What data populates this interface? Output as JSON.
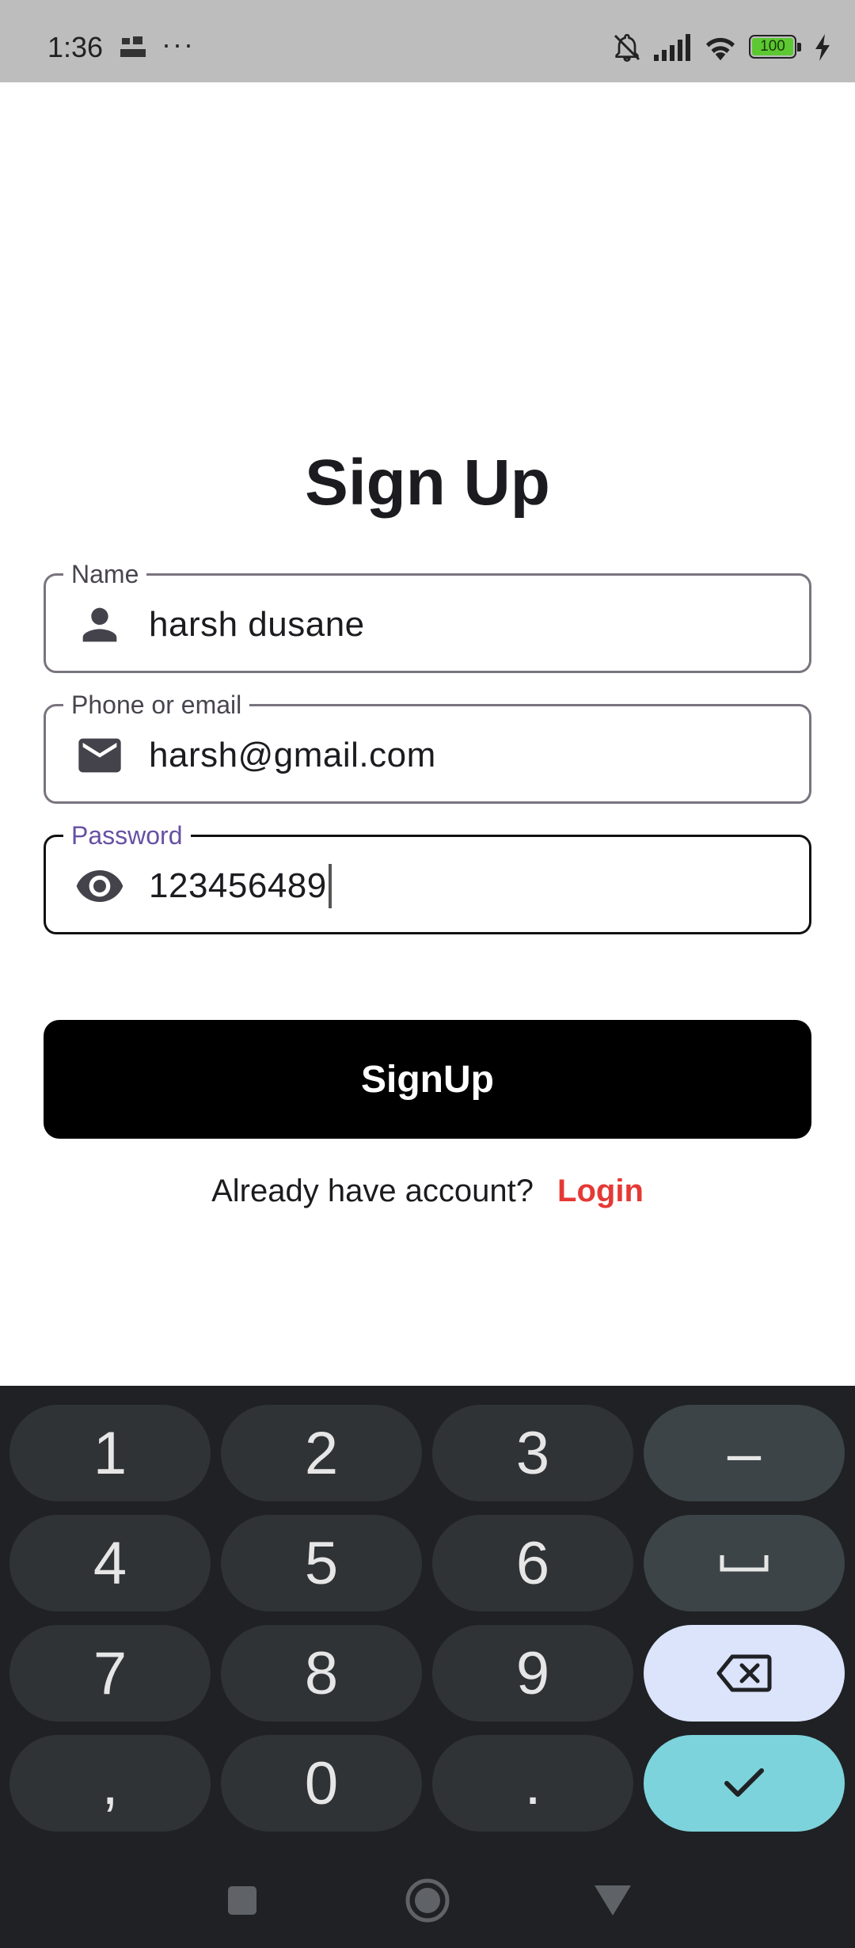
{
  "status_bar": {
    "time": "1:36",
    "notification_icon": "app-notification-icon",
    "more": "···",
    "battery": "100",
    "icons": [
      "bell-off-icon",
      "signal-icon",
      "wifi-icon",
      "battery-icon",
      "charging-icon"
    ]
  },
  "page": {
    "title": "Sign Up"
  },
  "form": {
    "name": {
      "label": "Name",
      "value": "harsh dusane",
      "icon": "person-icon"
    },
    "contact": {
      "label": "Phone or email",
      "value": "harsh@gmail.com",
      "icon": "mail-icon"
    },
    "password": {
      "label": "Password",
      "value": "123456489",
      "icon": "eye-icon",
      "focused": true
    },
    "submit_label": "SignUp"
  },
  "login_prompt": {
    "text": "Already have account?",
    "link": "Login"
  },
  "colors": {
    "accent_label": "#6750a4",
    "login_link": "#e53935",
    "button_bg": "#000000",
    "keyboard_bg": "#1f2124",
    "done_key": "#7dd3dc",
    "backspace_key": "#dbe4fb"
  },
  "keyboard": {
    "keys": [
      "1",
      "2",
      "3",
      "–",
      "4",
      "5",
      "6",
      "space",
      "7",
      "8",
      "9",
      "backspace",
      ",",
      "0",
      ".",
      "done"
    ]
  },
  "nav": {
    "buttons": [
      "recents-icon",
      "home-icon",
      "back-icon"
    ]
  }
}
